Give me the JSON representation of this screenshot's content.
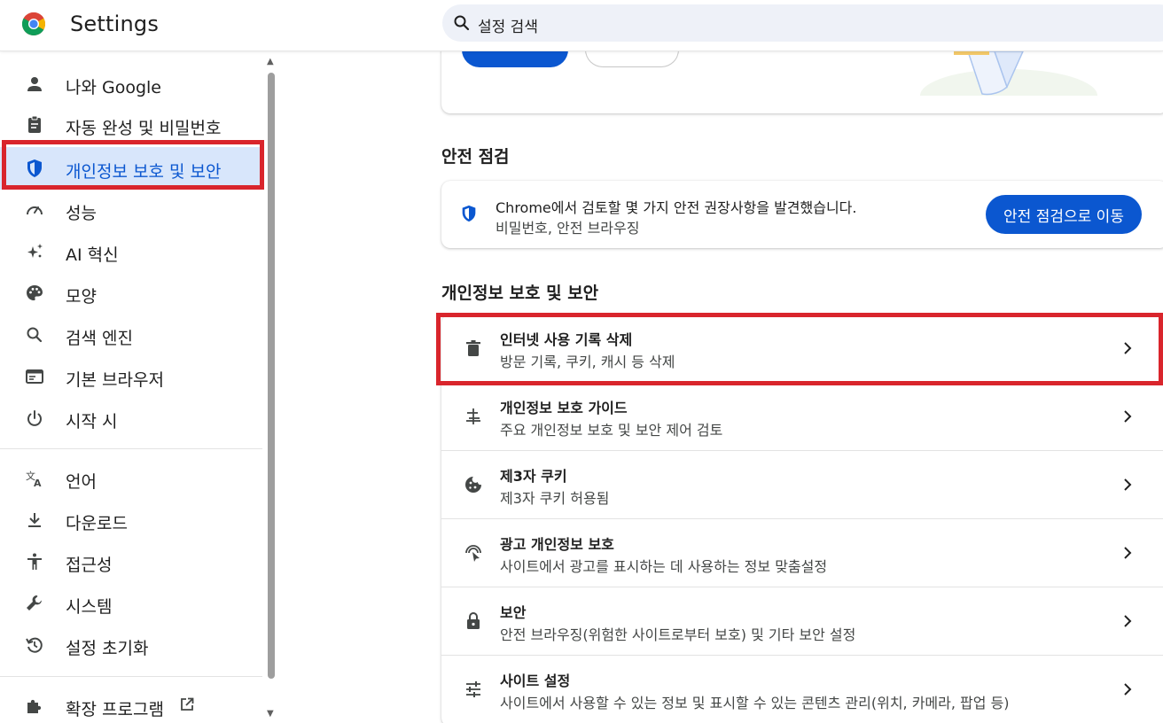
{
  "header": {
    "app_title": "Settings",
    "search": {
      "value": "설정 검색",
      "placeholder": "설정 검색"
    }
  },
  "sidebar": {
    "items": [
      {
        "label": "나와 Google",
        "icon": "person-icon"
      },
      {
        "label": "자동 완성 및 비밀번호",
        "icon": "clipboard-icon"
      },
      {
        "label": "개인정보 보호 및 보안",
        "icon": "shield-icon",
        "active": true
      },
      {
        "label": "성능",
        "icon": "speedometer-icon"
      },
      {
        "label": "AI 혁신",
        "icon": "sparkle-icon"
      },
      {
        "label": "모양",
        "icon": "palette-icon"
      },
      {
        "label": "검색 엔진",
        "icon": "search-icon"
      },
      {
        "label": "기본 브라우저",
        "icon": "browser-icon"
      },
      {
        "label": "시작 시",
        "icon": "power-icon"
      },
      {
        "label": "언어",
        "icon": "translate-icon"
      },
      {
        "label": "다운로드",
        "icon": "download-icon"
      },
      {
        "label": "접근성",
        "icon": "accessibility-icon"
      },
      {
        "label": "시스템",
        "icon": "wrench-icon"
      },
      {
        "label": "설정 초기화",
        "icon": "reset-icon"
      },
      {
        "label": "확장 프로그램",
        "icon": "puzzle-icon"
      }
    ]
  },
  "safety_check": {
    "section_title": "안전 점검",
    "message": "Chrome에서 검토할 몇 가지 안전 권장사항을 발견했습니다.",
    "detail": "비밀번호, 안전 브라우징",
    "button_label": "안전 점검으로 이동"
  },
  "privacy": {
    "section_title": "개인정보 보호 및 보안",
    "rows": [
      {
        "title": "인터넷 사용 기록 삭제",
        "subtitle": "방문 기록, 쿠키, 캐시 등 삭제",
        "icon": "trash-icon"
      },
      {
        "title": "개인정보 보호 가이드",
        "subtitle": "주요 개인정보 보호 및 보안 제어 검토",
        "icon": "guide-icon"
      },
      {
        "title": "제3자 쿠키",
        "subtitle": "제3자 쿠키 허용됨",
        "icon": "cookie-icon"
      },
      {
        "title": "광고 개인정보 보호",
        "subtitle": "사이트에서 광고를 표시하는 데 사용하는 정보 맞춤설정",
        "icon": "ad-privacy-icon"
      },
      {
        "title": "보안",
        "subtitle": "안전 브라우징(위험한 사이트로부터 보호) 및 기타 보안 설정",
        "icon": "lock-icon"
      },
      {
        "title": "사이트 설정",
        "subtitle": "사이트에서 사용할 수 있는 정보 및 표시할 수 있는 콘텐츠 관리(위치, 카메라, 팝업 등)",
        "icon": "sliders-icon"
      }
    ]
  },
  "colors": {
    "accent": "#0b57d0",
    "active_bg": "#d8e6fb",
    "highlight": "#d9252c"
  }
}
